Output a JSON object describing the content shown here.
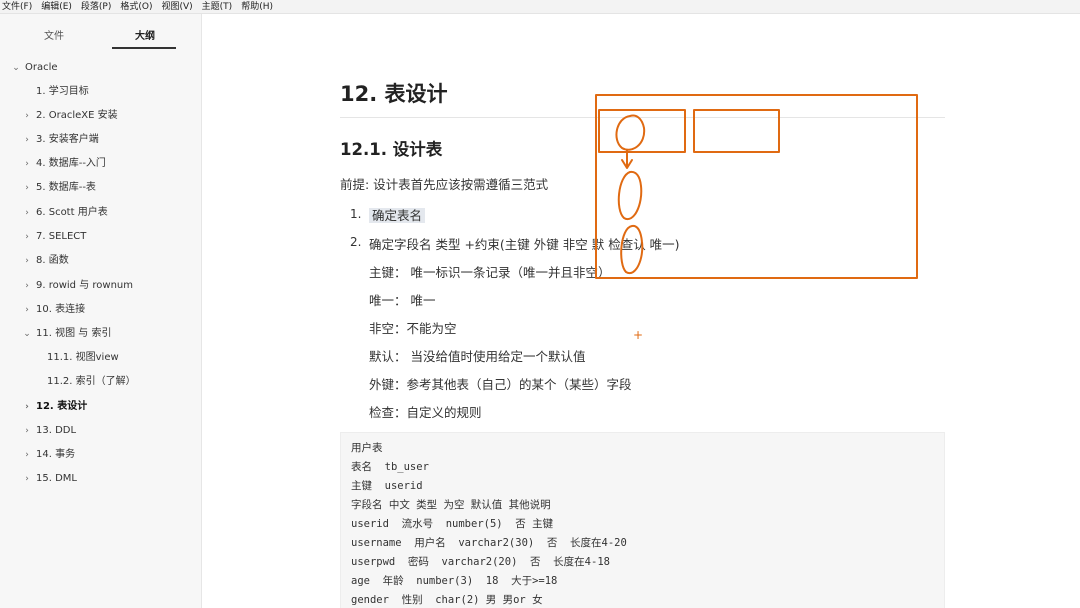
{
  "menu": [
    "文件(F)",
    "编辑(E)",
    "段落(P)",
    "格式(O)",
    "视图(V)",
    "主题(T)",
    "帮助(H)"
  ],
  "sidebar": {
    "tabs": {
      "files": "文件",
      "outline": "大纲"
    },
    "root": "Oracle",
    "items": [
      {
        "label": "1. 学习目标"
      },
      {
        "label": "2. OracleXE 安装"
      },
      {
        "label": "3. 安装客户端"
      },
      {
        "label": "4. 数据库--入门"
      },
      {
        "label": "5. 数据库--表"
      },
      {
        "label": "6. Scott 用户表"
      },
      {
        "label": "7. SELECT"
      },
      {
        "label": "8. 函数"
      },
      {
        "label": "9. rowid 与 rownum"
      },
      {
        "label": "10. 表连接"
      },
      {
        "label": "11. 视图 与 索引"
      },
      {
        "label": "11.1. 视图view"
      },
      {
        "label": "11.2. 索引（了解）"
      },
      {
        "label": "12. 表设计"
      },
      {
        "label": "13. DDL"
      },
      {
        "label": "14. 事务"
      },
      {
        "label": "15. DML"
      }
    ]
  },
  "doc": {
    "h1": "12. 表设计",
    "h2": "12.1. 设计表",
    "premise": "前提: 设计表首先应该按需遵循三范式",
    "ol": [
      {
        "num": "1.",
        "text": "确定表名"
      },
      {
        "num": "2.",
        "text": "确定字段名 类型 +约束(主键 外键 非空 默 检查认 唯一)"
      }
    ],
    "rules": [
      "主键：  唯一标识一条记录（唯一并且非空）",
      "唯一：  唯一",
      "非空：不能为空",
      "默认：  当没给值时使用给定一个默认值",
      "外键：参考其他表（自己）的某个（某些）字段",
      "检查：自定义的规则"
    ],
    "code": [
      "用户表",
      "表名  tb_user",
      "主键  userid",
      "字段名 中文 类型 为空 默认值 其他说明",
      "userid  流水号  number(5)  否 主键",
      "username  用户名  varchar2(30)  否  长度在4-20",
      "userpwd  密码  varchar2(20)  否  长度在4-18",
      "age  年龄  number(3)  18  大于>=18",
      "gender  性别  char(2) 男 男or 女"
    ]
  },
  "annotation": {
    "stroke_color": "#e06a12",
    "plus_marker": "+"
  }
}
